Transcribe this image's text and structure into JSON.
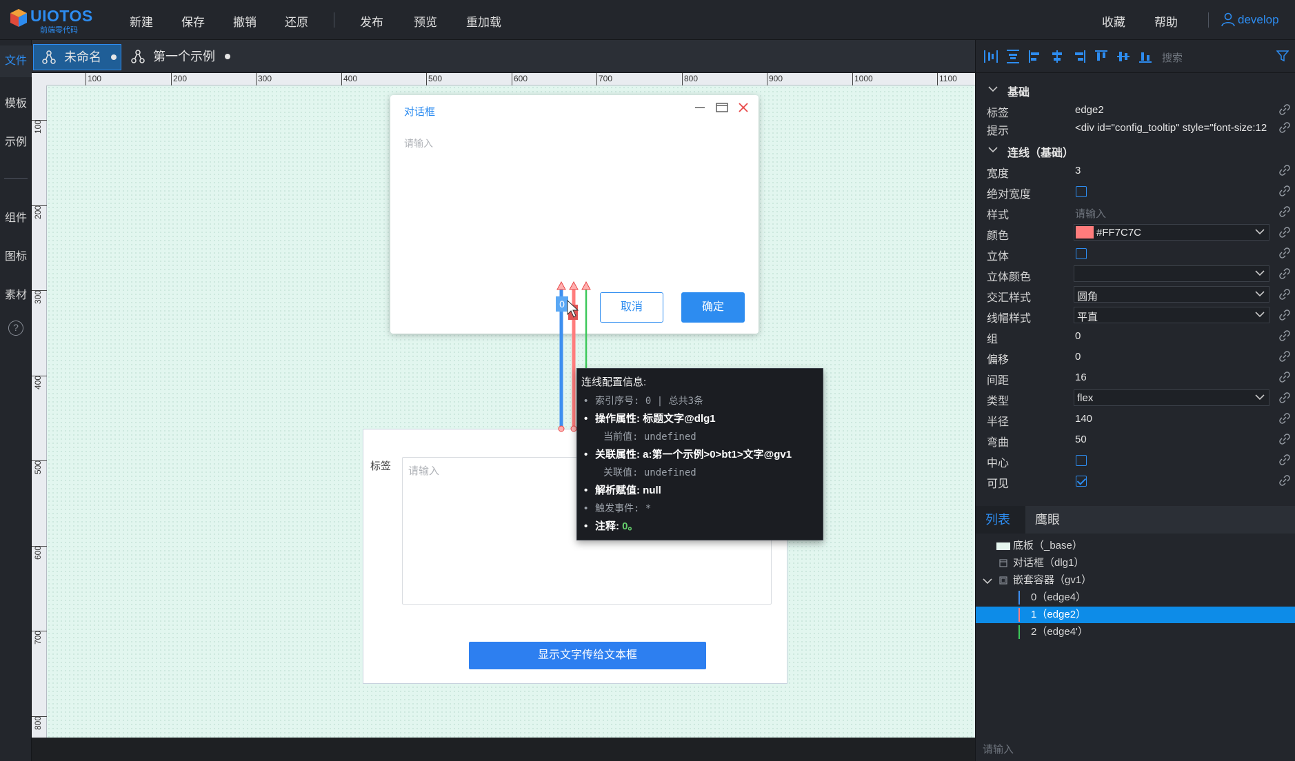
{
  "app": {
    "brand": "UIOTOS",
    "subtitle": "前端零代码",
    "user": "develop"
  },
  "menu": {
    "left": [
      "新建",
      "保存",
      "撤销",
      "还原"
    ],
    "middle": [
      "发布",
      "预览",
      "重加载"
    ],
    "right": [
      "收藏",
      "帮助"
    ]
  },
  "leftnav": {
    "items": [
      "文件",
      "模板",
      "示例",
      "组件",
      "图标",
      "素材"
    ],
    "help": "?"
  },
  "tabs": [
    {
      "label": "未命名",
      "active": true
    },
    {
      "label": "第一个示例",
      "active": false
    }
  ],
  "ruler": {
    "top": [
      "100",
      "200",
      "300",
      "400",
      "500",
      "600",
      "700",
      "800",
      "900",
      "1000",
      "1100"
    ],
    "left": [
      "100",
      "200",
      "300",
      "400",
      "500",
      "600",
      "700",
      "800"
    ]
  },
  "dialog": {
    "title": "对话框",
    "placeholder": "请输入",
    "cancel": "取消",
    "ok": "确定"
  },
  "container": {
    "label": "标签",
    "placeholder": "请输入",
    "button": "显示文字传给文本框"
  },
  "edge_label": "0",
  "tooltip": {
    "title": "连线配置信息:",
    "index": "索引序号: 0 | 总共3条",
    "op_attr": "操作属性: 标题文字@dlg1",
    "current": "当前值: undefined",
    "link_attr": "关联属性: a:第一个示例>0>bt1>文字@gv1",
    "link_value": "关联值: undefined",
    "parse": "解析赋值: null",
    "trigger": "触发事件: *",
    "note_key": "注释: ",
    "note_val": "0。"
  },
  "panel": {
    "search_placeholder": "搜索",
    "section_basic": "基础",
    "section_edge": "连线（基础）",
    "props": {
      "tag": {
        "k": "标签",
        "v": "edge2"
      },
      "tip": {
        "k": "提示",
        "v": "<div id=\"config_tooltip\" style=\"font-size:12"
      },
      "width": {
        "k": "宽度",
        "v": "3"
      },
      "abs_width": {
        "k": "绝对宽度"
      },
      "style": {
        "k": "样式",
        "v": "请输入"
      },
      "color": {
        "k": "颜色",
        "v": "#FF7C7C"
      },
      "solid": {
        "k": "立体"
      },
      "solid_color": {
        "k": "立体颜色",
        "v": ""
      },
      "join": {
        "k": "交汇样式",
        "v": "圆角"
      },
      "cap": {
        "k": "线帽样式",
        "v": "平直"
      },
      "group": {
        "k": "组",
        "v": "0"
      },
      "offset": {
        "k": "偏移",
        "v": "0"
      },
      "gap": {
        "k": "间距",
        "v": "16"
      },
      "type": {
        "k": "类型",
        "v": "flex"
      },
      "radius": {
        "k": "半径",
        "v": "140"
      },
      "bend": {
        "k": "弯曲",
        "v": "50"
      },
      "center": {
        "k": "中心"
      },
      "visible": {
        "k": "可见"
      }
    },
    "bottom_tabs": [
      "列表",
      "鹰眼"
    ],
    "tree": [
      {
        "label": "底板（_base）"
      },
      {
        "label": "对话框（dlg1）"
      },
      {
        "label": "嵌套容器（gv1）"
      },
      {
        "label": "0（edge4）"
      },
      {
        "label": "1（edge2）"
      },
      {
        "label": "2（edge4'）"
      }
    ],
    "footer_placeholder": "请输入"
  },
  "colors": {
    "accent": "#2d8cf0",
    "edge_blue": "#3d8ff0",
    "edge_red": "#FF7C7C",
    "edge_green": "#3cc85a"
  }
}
